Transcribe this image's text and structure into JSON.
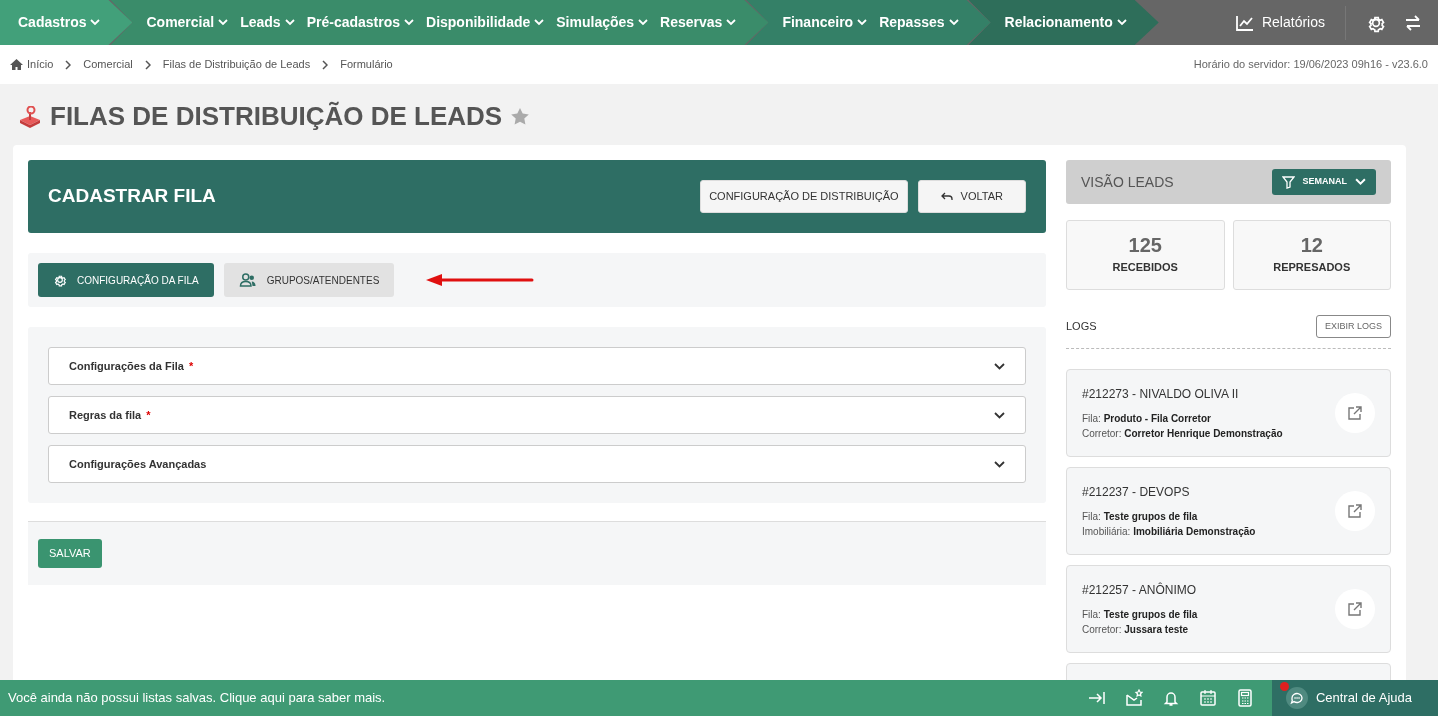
{
  "nav": {
    "segments": [
      {
        "items": [
          "Cadastros"
        ]
      },
      {
        "items": [
          "Comercial",
          "Leads",
          "Pré-cadastros",
          "Disponibilidade",
          "Simulações",
          "Reservas"
        ]
      },
      {
        "items": [
          "Financeiro",
          "Repasses"
        ]
      },
      {
        "items": [
          "Relacionamento"
        ]
      }
    ],
    "reports": "Relatórios"
  },
  "breadcrumb": [
    "Início",
    "Comercial",
    "Filas de Distribuição de Leads",
    "Formulário"
  ],
  "server_info": "Horário do servidor: 19/06/2023 09h16 - v23.6.0",
  "page_title": "FILAS DE DISTRIBUIÇÃO DE LEADS",
  "favorite": false,
  "form": {
    "title": "CADASTRAR FILA",
    "header_buttons": [
      {
        "label": "CONFIGURAÇÃO DE DISTRIBUIÇÃO",
        "kind": "plain"
      },
      {
        "label": "VOLTAR",
        "kind": "back"
      }
    ],
    "tabs": [
      {
        "label": "CONFIGURAÇÃO DA FILA",
        "selected": true
      },
      {
        "label": "GRUPOS/ATENDENTES",
        "selected": false
      }
    ],
    "sections": [
      {
        "label": "Configurações da Fila",
        "marker": "*",
        "expanded": false
      },
      {
        "label": "Regras da fila",
        "marker": "*",
        "expanded": false
      },
      {
        "label": "Configurações Avançadas",
        "expanded": false
      }
    ],
    "save": "SALVAR"
  },
  "leads_view": {
    "title": "VISÃO LEADS",
    "filter": "SEMANAL",
    "stats": [
      {
        "value": "125",
        "label": "RECEBIDOS"
      },
      {
        "value": "12",
        "label": "REPRESADOS"
      }
    ],
    "logs_title": "LOGS",
    "logs_button": "EXIBIR LOGS",
    "logs": [
      {
        "title": "#212273 - NIVALDO OLIVA II",
        "lines": [
          "Fila: **Produto - Fila Corretor**",
          "Corretor: **Corretor Henrique Demonstração**"
        ]
      },
      {
        "title": "#212237 - DEVOPS",
        "lines": [
          "Fila: **Teste grupos de fila**",
          "Imobiliária: **Imobiliária Demonstração**"
        ]
      },
      {
        "title": "#212257 - ANÔNIMO",
        "lines": [
          "Fila: **Teste grupos de fila**",
          "Corretor: **Jussara teste**"
        ]
      }
    ]
  },
  "footer": {
    "message": "Você ainda não possui listas salvas. Clique aqui para saber mais.",
    "help": "Central de Ajuda",
    "help_notification": true
  }
}
